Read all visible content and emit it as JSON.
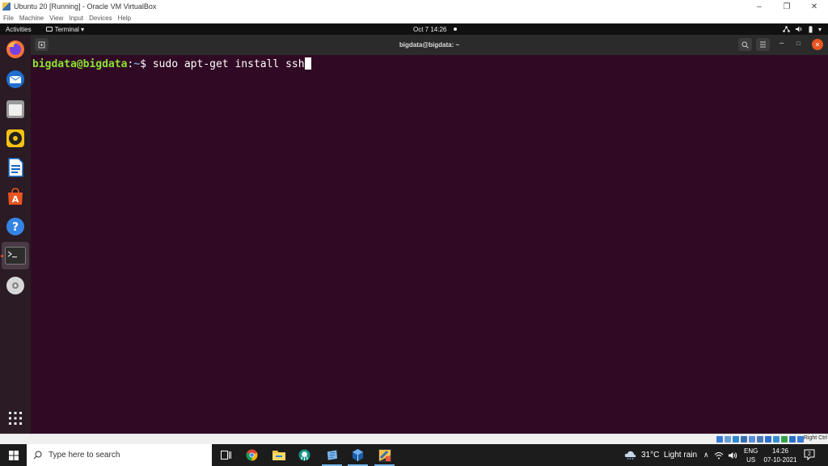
{
  "vbox": {
    "title": "Ubuntu 20 [Running] - Oracle VM VirtualBox",
    "menu": [
      "File",
      "Machine",
      "View",
      "Input",
      "Devices",
      "Help"
    ],
    "host_key": "Right Ctrl"
  },
  "ubuntu": {
    "activities": "Activities",
    "app_menu": "Terminal ▾",
    "clock": "Oct 7  14:26",
    "dock_icons": [
      "firefox-icon",
      "thunderbird-icon",
      "files-icon",
      "rhythmbox-icon",
      "libreoffice-writer-icon",
      "ubuntu-software-icon",
      "help-icon",
      "terminal-icon",
      "dvd-icon",
      "show-applications-icon"
    ]
  },
  "terminal": {
    "title": "bigdata@bigdata: ~",
    "prompt_user": "bigdata@bigdata",
    "prompt_sep": ":",
    "prompt_path": "~",
    "prompt_dollar": "$ ",
    "command": "sudo apt-get install ssh"
  },
  "taskbar": {
    "search_placeholder": "Type here to search",
    "weather": "31°C  Light rain",
    "lang_top": "ENG",
    "lang_bottom": "US",
    "time": "14:26",
    "date": "07-10-2021",
    "notifications": "2",
    "icons": [
      "task-view-icon",
      "chrome-icon",
      "file-explorer-icon",
      "gitkraken-icon",
      "notepad-icon",
      "virtualbox-icon",
      "vbox-vm-icon"
    ]
  },
  "colors": {
    "terminal_bg": "#300a24",
    "prompt_green": "#8ae234",
    "prompt_blue": "#729fcf",
    "ubuntu_orange": "#e95420"
  }
}
